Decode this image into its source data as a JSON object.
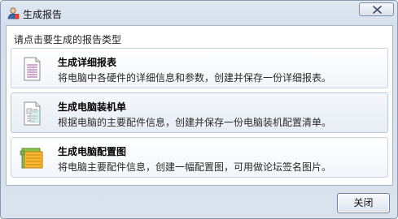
{
  "window": {
    "title": "生成报告",
    "close_symbol": "✕"
  },
  "prompt": "请点击要生成的报告类型",
  "options": [
    {
      "title": "生成详细报表",
      "desc": "将电脑中各硬件的详细信息和参数，创建并保存一份详细报表。",
      "icon": "report-sheet-icon"
    },
    {
      "title": "生成电脑装机单",
      "desc": "根据电脑的主要配件信息，创建并保存一份电脑装机配置清单。",
      "icon": "document-list-icon"
    },
    {
      "title": "生成电脑配置图",
      "desc": "将电脑主要配件信息，创建一幅配置图，可用做论坛签名图片。",
      "icon": "config-image-icon"
    }
  ],
  "footer": {
    "close_label": "关闭"
  },
  "colors": {
    "frame": "#d6e0ec",
    "content_bg": "#ffffff",
    "border": "#8a99ad"
  }
}
